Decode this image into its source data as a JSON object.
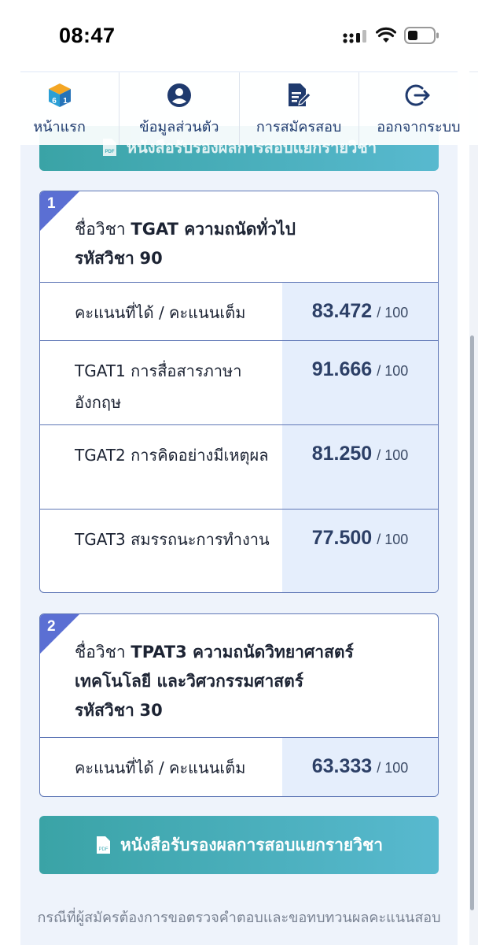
{
  "status_bar": {
    "time": "08:47"
  },
  "nav": {
    "items": [
      {
        "label": "หน้าแรก",
        "icon": "cube-61-icon"
      },
      {
        "label": "ข้อมูลส่วนตัว",
        "icon": "user-circle-icon"
      },
      {
        "label": "การสมัครสอบ",
        "icon": "document-edit-icon"
      },
      {
        "label": "ออกจากระบบ",
        "icon": "logout-icon"
      }
    ]
  },
  "top_button": {
    "label": "หนังสือรับรองผลการสอบแยกรายวิชา"
  },
  "cards": [
    {
      "index": "1",
      "name_prefix": "ชื่อวิชา",
      "name": "TGAT ความถนัดทั่วไป",
      "code_prefix": "รหัสวิชา",
      "code": "90",
      "rows": [
        {
          "label": "คะแนนที่ได้ / คะแนนเต็ม",
          "score": "83.472",
          "max": "/ 100"
        },
        {
          "label": "TGAT1 การสื่อสารภาษาอังกฤษ",
          "score": "91.666",
          "max": "/ 100"
        },
        {
          "label": "TGAT2 การคิดอย่างมีเหตุผล",
          "score": "81.250",
          "max": "/ 100"
        },
        {
          "label": "TGAT3 สมรรถนะการทำงาน",
          "score": "77.500",
          "max": "/ 100"
        }
      ]
    },
    {
      "index": "2",
      "name_prefix": "ชื่อวิชา",
      "name": "TPAT3 ความถนัดวิทยาศาสตร์ เทคโนโลยี และวิศวกรรมศาสตร์",
      "code_prefix": "รหัสวิชา",
      "code": "30",
      "rows": [
        {
          "label": "คะแนนที่ได้ / คะแนนเต็ม",
          "score": "63.333",
          "max": "/ 100"
        }
      ]
    }
  ],
  "bottom_button": {
    "label": "หนังสือรับรองผลการสอบแยกรายวิชา"
  },
  "note": "กรณีที่ผู้สมัครต้องการขอตรวจคำตอบและขอทบทวนผลคะแนนสอบ",
  "colors": {
    "accent_teal": "#3aa3a6",
    "card_border": "#5f77b6",
    "corner_badge": "#5b6fd3",
    "score_bg": "#e5eefc"
  }
}
